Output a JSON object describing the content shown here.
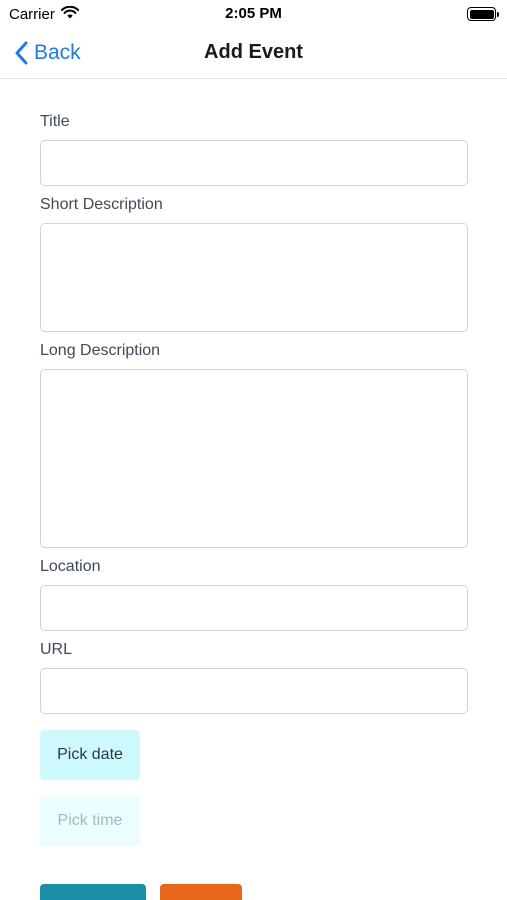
{
  "status_bar": {
    "carrier": "Carrier",
    "time": "2:05 PM"
  },
  "nav": {
    "back_label": "Back",
    "title": "Add Event"
  },
  "form": {
    "title_label": "Title",
    "title_value": "",
    "short_description_label": "Short Description",
    "short_description_value": "",
    "long_description_label": "Long Description",
    "long_description_value": "",
    "location_label": "Location",
    "location_value": "",
    "url_label": "URL",
    "url_value": "",
    "pick_date_label": "Pick date",
    "pick_time_label": "Pick time"
  },
  "colors": {
    "accent_blue": "#1e7ce0",
    "primary_button": "#1a8fa8",
    "secondary_button": "#e8661a",
    "pick_date_bg": "#cdf9fc",
    "pick_time_bg": "#ebfdfe"
  }
}
